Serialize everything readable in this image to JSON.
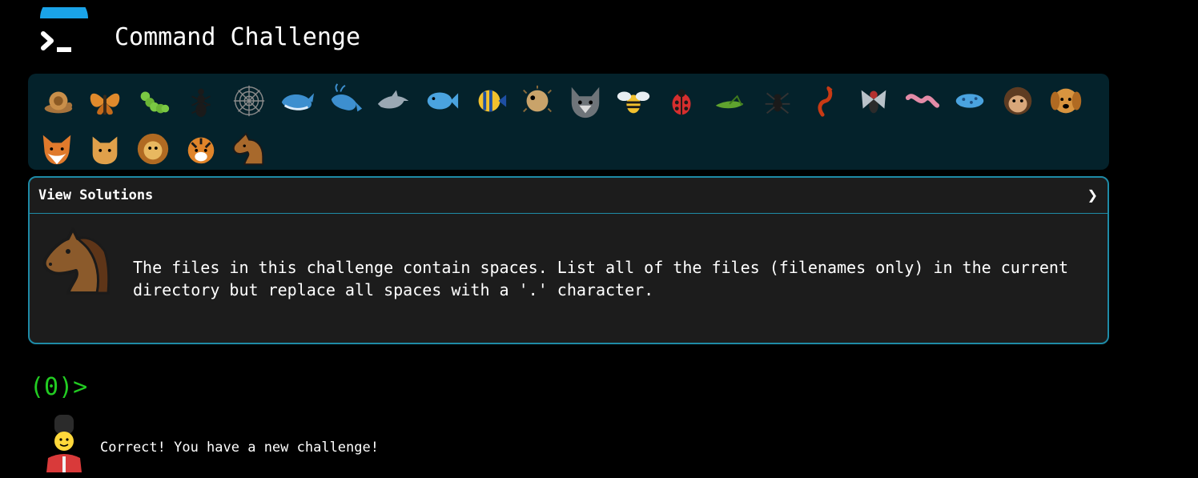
{
  "app": {
    "title": "Command Challenge"
  },
  "levels": [
    "snail-icon",
    "butterfly-icon",
    "caterpillar-icon",
    "ant-icon",
    "spider-web-icon",
    "whale-icon",
    "whale-spout-icon",
    "dolphin-icon",
    "fish-icon",
    "tropical-fish-icon",
    "blowfish-icon",
    "wolf-icon",
    "bee-icon",
    "ladybug-icon",
    "cricket-icon",
    "spider-icon",
    "scorpion-icon",
    "fly-icon",
    "worm-icon",
    "microbe-icon",
    "monkey-icon",
    "dog-icon",
    "fox-icon",
    "cat-icon",
    "lion-icon",
    "tiger-icon",
    "horse-icon"
  ],
  "panel": {
    "header": "View Solutions",
    "chevron": "❯",
    "challenge_text": "The files in this challenge contain spaces. List all of the files (filenames only) in the current directory but replace all spaces with a '.' character.",
    "icon": "horse-icon"
  },
  "prompt": {
    "text": "(0)>"
  },
  "feedback": {
    "icon": "guard-icon",
    "text": "Correct! You have a new challenge!"
  },
  "colors": {
    "panel_border": "#1e8aa6",
    "level_bar_bg": "#04222b",
    "prompt_green": "#22cc22"
  }
}
